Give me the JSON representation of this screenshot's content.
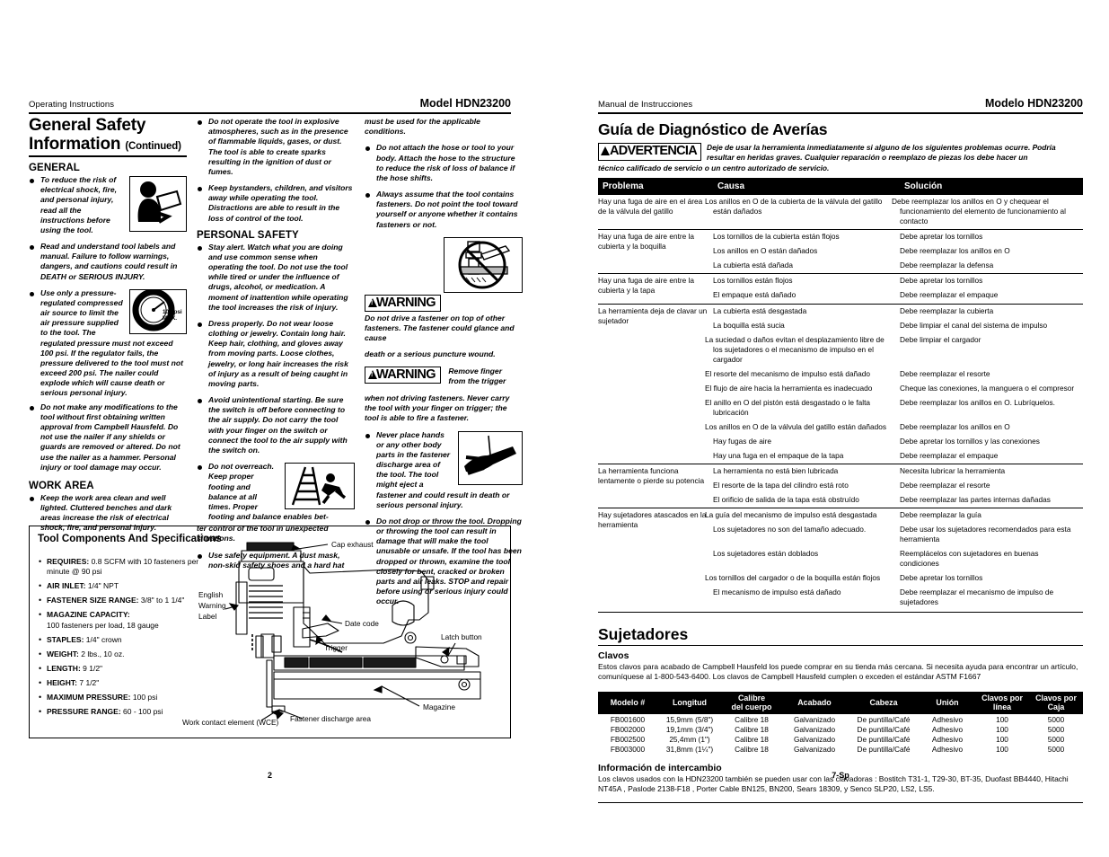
{
  "left_page": {
    "running_head": "Operating Instructions",
    "model": "Model HDN23200",
    "title_main": "General Safety",
    "title_second": "Information",
    "title_continued": "(Continued)",
    "sections": {
      "general": "GENERAL",
      "work_area": "WORK AREA",
      "personal_safety": "PERSONAL SAFETY"
    },
    "general_items": [
      "To reduce the risk of electrical shock, fire, and personal injury, read all the instructions before using the tool.",
      "Read and understand tool labels and manual. Failure to follow warnings, dangers, and cautions could result in DEATH or SERIOUS INJURY.",
      "Use only a pressure-regulated compressed air source to limit the air pressure supplied to the tool. The regulated pressure must not exceed 100 psi. If the regulator fails, the pressure delivered to the tool must not exceed 200 psi. The nailer could explode which will cause death or serious personal injury.",
      "Do not make any modifications to the tool without first obtaining written approval from Campbell Hausfeld. Do not use the nailer if any shields or guards are removed or altered. Do not use the nailer as a hammer. Personal injury or tool damage may occur."
    ],
    "gauge_label_line1": "100 psi",
    "gauge_label_line2": "MAX.",
    "work_area_items": [
      "Keep the work area clean and well lighted. Cluttered benches and dark areas increase the risk of electrical shock, fire, and personal injury."
    ],
    "col_b_items": [
      "Do not operate the tool in explosive atmospheres, such as in the presence of flammable liquids, gases, or dust. The tool is able to create sparks resulting in the ignition of dust or fumes.",
      "Keep bystanders, children, and visitors away while operating the tool. Distractions are able to result in the loss of control of the tool."
    ],
    "personal_safety_items": [
      "Stay alert. Watch what you are doing and use common sense when operating the tool. Do not use the tool while tired or under the influence of drugs, alcohol, or medication. A moment of inattention while operating the tool increases the risk of injury.",
      "Dress properly. Do not wear loose clothing or jewelry. Contain long hair. Keep hair, clothing, and gloves away from moving parts. Loose clothes, jewelry, or long hair increases the risk of injury as a result of being caught in moving parts.",
      "Avoid unintentional starting. Be sure the switch is off before connecting to the air supply. Do not carry the tool with your finger on the switch or connect the tool to the air supply with the switch on."
    ],
    "overreach_head": "Do not overreach.",
    "overreach_wrap": "Keep proper footing and balance at all times. Proper footing and balance enables bet-",
    "overreach_after": "ter control of the tool in unexpected situations.",
    "safety_equipment_item": "Use safety equipment. A dust mask, non-skid safety shoes and a hard hat",
    "col_c_continue": "must be used for the applicable conditions.",
    "col_c_items": [
      "Do not attach the hose or tool to your body. Attach the hose to the structure to reduce the risk of loss of balance if the hose shifts.",
      "Always assume that the tool contains fasteners. Do not point the tool toward yourself or anyone whether it contains fasteners or not."
    ],
    "warning_label": "WARNING",
    "warning1_wrap": "Do not drive a fastener on top of other fasteners. The fastener could glance and cause",
    "warning1_after": "death or a serious puncture wound.",
    "warning2_wrap": "Remove finger from the trigger",
    "warning2_after": "when not driving fasteners. Never carry the tool with your finger on trigger; the tool is able to fire a fastener.",
    "col_c_items2": [
      "Never place hands or any other body parts in the fastener discharge area of the tool. The tool might eject a fastener and could result in death or serious personal injury.",
      "Do not drop or throw the tool. Dropping or throwing the tool can result in damage that will make the tool unusable or unsafe. If the tool has been dropped or thrown, examine the tool closely for bent, cracked or broken parts and air leaks. STOP and repair before using or serious injury could occur."
    ],
    "spec_title": "Tool Components And Specifications",
    "specs": [
      {
        "label": "REQUIRES:",
        "value": "0.8 SCFM with 10 fasteners per minute @ 90 psi"
      },
      {
        "label": "AIR INLET:",
        "value": "1/4\" NPT"
      },
      {
        "label": "FASTENER SIZE RANGE:",
        "value": "3/8\" to 1 1/4\""
      },
      {
        "label": "MAGAZINE CAPACITY:",
        "value": "100 fasteners per load, 18 gauge"
      },
      {
        "label": "STAPLES:",
        "value": "1/4\" crown"
      },
      {
        "label": "WEIGHT:",
        "value": "2 lbs., 10 oz."
      },
      {
        "label": "LENGTH:",
        "value": "9 1/2\""
      },
      {
        "label": "HEIGHT:",
        "value": "7 1/2\""
      },
      {
        "label": "MAXIMUM PRESSURE:",
        "value": "100 psi"
      },
      {
        "label": "PRESSURE RANGE:",
        "value": "60 - 100 psi"
      }
    ],
    "diagram_labels": {
      "cap_exhaust": "Cap exhaust",
      "date_code": "Date code",
      "latch_button": "Latch button",
      "trigger": "Trigger",
      "magazine": "Magazine",
      "fastener_discharge": "Fastener discharge area",
      "wce": "Work contact element (WCE)",
      "english_warning_label": "English\nWarning\nLabel"
    },
    "page_number": "2"
  },
  "right_page": {
    "running_head": "Manual de Instrucciones",
    "model": "Modelo HDN23200",
    "title": "Guía de Diagnóstico de Averías",
    "advertencia_label": "ADVERTENCIA",
    "advertencia_text": "Deje de usar la herramienta inmediatamente si alguno de los siguientes problemas ocurre. Podría resultar en heridas graves. Cualquier reparación o reemplazo de piezas los debe hacer un",
    "advertencia_text2": "técnico calificado de servicio o un centro autorizado de servicio.",
    "table_headers": [
      "Problema",
      "Causa",
      "Solución"
    ],
    "table_groups": [
      {
        "problem": "Hay una fuga de aire en el área de la válvula del gatillo",
        "rows": [
          {
            "cause": "Los anillos en O de la cubierta de la válvula del gatillo están dañados",
            "solution": "Debe reemplazar los anillos en O y chequear el funcionamiento del elemento de funcionamiento al contacto"
          }
        ]
      },
      {
        "problem": "Hay una fuga de aire entre la cubierta y la boquilla",
        "rows": [
          {
            "cause": "Los tornillos de la cubierta están flojos",
            "solution": "Debe apretar los tornillos"
          },
          {
            "cause": "Los anillos en O están dañados",
            "solution": "Debe reemplazar los anillos en O"
          },
          {
            "cause": "La cubierta está dañada",
            "solution": "Debe reemplazar la defensa"
          }
        ]
      },
      {
        "problem": "Hay una fuga de aire entre la cubierta y la tapa",
        "rows": [
          {
            "cause": "Los tornillos están flojos",
            "solution": "Debe apretar los tornillos"
          },
          {
            "cause": "El empaque está dañado",
            "solution": "Debe reemplazar el empaque"
          }
        ]
      },
      {
        "problem": "La herramienta deja de clavar un sujetador",
        "rows": [
          {
            "cause": "La cubierta está desgastada",
            "solution": "Debe reemplazar la cubierta"
          },
          {
            "cause": "La boquilla está sucia",
            "solution": "Debe limpiar el canal del sistema de impulso"
          },
          {
            "cause": "La suciedad o daños evitan el desplazamiento libre de los sujetadores o el mecanismo de impulso en el cargador",
            "solution": "Debe limpiar el cargador"
          },
          {
            "cause": "El resorte del mecanismo de impulso está dañado",
            "solution": "Debe reemplazar el resorte"
          },
          {
            "cause": "El flujo de aire hacia la herramienta es inadecuado",
            "solution": "Cheque las conexiones, la manguera o el compresor"
          },
          {
            "cause": "El anillo en O del pistón está desgastado o le falta lubricación",
            "solution": "Debe reemplazar los anillos en O. Lubríquelos."
          },
          {
            "cause": "Los anillos en O de la válvula del gatillo están dañados",
            "solution": "Debe reemplazar los anillos en O"
          },
          {
            "cause": "Hay fugas de aire",
            "solution": "Debe apretar los tornillos y las conexiones"
          },
          {
            "cause": "Hay una fuga en el empaque de la tapa",
            "solution": "Debe reemplazar el empaque"
          }
        ]
      },
      {
        "problem": "La herramienta funciona lentamente o pierde su potencia",
        "rows": [
          {
            "cause": "La herramienta no está bien lubricada",
            "solution": "Necesita lubricar la herramienta"
          },
          {
            "cause": "El resorte de la tapa del cilindro está roto",
            "solution": "Debe reemplazar el resorte"
          },
          {
            "cause": "El orificio de salida de la tapa está obstruído",
            "solution": "Debe reemplazar las partes internas dañadas"
          }
        ]
      },
      {
        "problem": "Hay sujetadores atascados en la herramienta",
        "rows": [
          {
            "cause": "La guía del mecanismo de impulso está desgastada",
            "solution": "Debe reemplazar la guía"
          },
          {
            "cause": "Los sujetadores no son del tamaño adecuado.",
            "solution": "Debe usar los sujetadores recomendados para esta herramienta"
          },
          {
            "cause": "Los sujetadores están doblados",
            "solution": "Reemplácelos con sujetadores en buenas condiciones"
          },
          {
            "cause": "Los tornillos del cargador o de la boquilla están flojos",
            "solution": "Debe apretar los tornillos"
          },
          {
            "cause": "El mecanismo de impulso está dañado",
            "solution": "Debe reemplazar el mecanismo de impulso de sujetadores"
          }
        ]
      }
    ],
    "fasteners_title": "Sujetadores",
    "nails_heading": "Clavos",
    "nails_text": "Estos clavos para acabado de Campbell Hausfeld los puede comprar en su tienda más cercana. Si necesita ayuda para encontrar un artículo, comuníquese al  1-800-543-6400. Los clavos de Campbell Hausfeld cumplen o exceden el estándar ASTM F1667",
    "nail_table_headers": [
      "Modelo #",
      "Longitud",
      "Calibre\ndel cuerpo",
      "Acabado",
      "Cabeza",
      "Unión",
      "Clavos por\nlínea",
      "Clavos por\nCaja"
    ],
    "nail_rows": [
      [
        "FB001600",
        "15,9mm (5/8\")",
        "Calibre 18",
        "Galvanizado",
        "De puntilla/Café",
        "Adhesivo",
        "100",
        "5000"
      ],
      [
        "FB002000",
        "19,1mm (3/4\")",
        "Calibre 18",
        "Galvanizado",
        "De puntilla/Café",
        "Adhesivo",
        "100",
        "5000"
      ],
      [
        "FB002500",
        "25,4mm (1\")",
        "Calibre 18",
        "Galvanizado",
        "De puntilla/Café",
        "Adhesivo",
        "100",
        "5000"
      ],
      [
        "FB003000",
        "31,8mm (1¼\")",
        "Calibre 18",
        "Galvanizado",
        "De puntilla/Café",
        "Adhesivo",
        "100",
        "5000"
      ]
    ],
    "interchange_heading": "Información de intercambio",
    "interchange_text": "Los clavos usados con la HDN23200 también se pueden usar con las clavadoras : Bostitch T31-1, T29-30, BT-35, Duofast BB4440, Hitachi NT45A , Paslode 2138-F18 , Porter Cable BN125, BN200, Sears 18309, y Senco SLP20, LS2, LS5.",
    "page_number": "7-Sp"
  }
}
